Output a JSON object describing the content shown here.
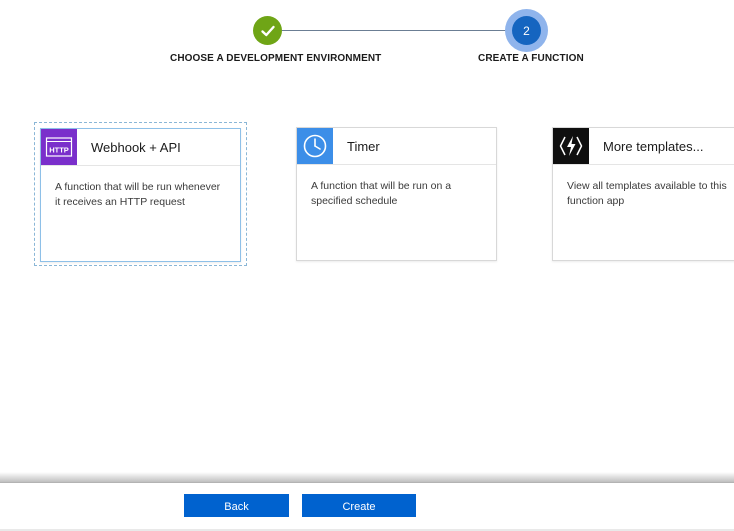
{
  "stepper": {
    "steps": [
      {
        "number": "",
        "label": "CHOOSE A DEVELOPMENT ENVIRONMENT",
        "state": "complete"
      },
      {
        "number": "2",
        "label": "CREATE A FUNCTION",
        "state": "active"
      }
    ]
  },
  "cards": [
    {
      "icon": "http-icon",
      "icon_text": "HTTP",
      "title": "Webhook + API",
      "description": "A function that will be run whenever it receives an HTTP request",
      "selected": true
    },
    {
      "icon": "clock-icon",
      "title": "Timer",
      "description": "A function that will be run on a specified schedule",
      "selected": false
    },
    {
      "icon": "lightning-icon",
      "title": "More templates...",
      "description": "View all templates available to this function app",
      "selected": false
    }
  ],
  "footer": {
    "back_label": "Back",
    "create_label": "Create"
  },
  "colors": {
    "complete": "#6fa516",
    "active": "#1565c0",
    "active_halo": "#8fb4ec",
    "button": "#0062cf",
    "http_icon_bg": "#7a2fcb",
    "timer_icon_bg": "#3c8ee8",
    "more_icon_bg": "#0f0f0f"
  }
}
